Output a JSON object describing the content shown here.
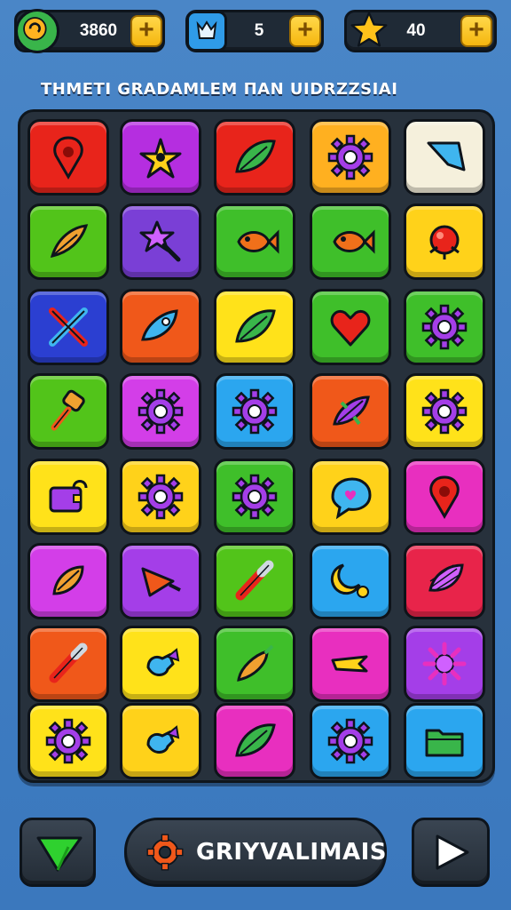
{
  "hud": {
    "coins": {
      "value": "3860",
      "icon": "swirl-coin-icon",
      "color": "#39b54a"
    },
    "powerups": {
      "value": "5",
      "icon": "cat-powerup-icon",
      "color": "#2f9be8"
    },
    "stars": {
      "value": "40",
      "icon": "star-icon",
      "color": "#ffc21a"
    },
    "plus_label": "+"
  },
  "subtitle": "THMETI GRADAMLEM ΠΑΝ UIDRZZSIAI",
  "board": {
    "rows": [
      [
        {
          "color": "#e8241b",
          "icon": "map-pin-icon"
        },
        {
          "color": "#b52ee0",
          "icon": "starfish-icon"
        },
        {
          "color": "#e8241b",
          "icon": "leaf-icon"
        },
        {
          "color": "#ffb020",
          "icon": "gear-icon"
        },
        {
          "color": "#f5f0dc",
          "icon": "sail-shard-icon"
        }
      ],
      [
        {
          "color": "#52c41a",
          "icon": "feather-icon"
        },
        {
          "color": "#7a3fd6",
          "icon": "star-wand-icon"
        },
        {
          "color": "#3fbf2a",
          "icon": "fish-icon"
        },
        {
          "color": "#3fbf2a",
          "icon": "fish-icon"
        },
        {
          "color": "#ffd21a",
          "icon": "beetle-icon"
        }
      ],
      [
        {
          "color": "#2b3fd1",
          "icon": "crossed-swords-icon"
        },
        {
          "color": "#f0581a",
          "icon": "rocket-icon"
        },
        {
          "color": "#ffe21a",
          "icon": "leaf-icon"
        },
        {
          "color": "#3fbf2a",
          "icon": "heart-icon"
        },
        {
          "color": "#3fbf2a",
          "icon": "gear-icon"
        }
      ],
      [
        {
          "color": "#52c41a",
          "icon": "hammer-icon"
        },
        {
          "color": "#d33ee8",
          "icon": "gear-icon"
        },
        {
          "color": "#2ba6ef",
          "icon": "gear-icon"
        },
        {
          "color": "#f0581a",
          "icon": "bug-icon"
        },
        {
          "color": "#ffe21a",
          "icon": "gear-icon"
        }
      ],
      [
        {
          "color": "#ffe21a",
          "icon": "purse-icon"
        },
        {
          "color": "#ffd21a",
          "icon": "gear-icon"
        },
        {
          "color": "#3fbf2a",
          "icon": "gear-icon"
        },
        {
          "color": "#ffd21a",
          "icon": "chat-bubble-icon"
        },
        {
          "color": "#e82fbf",
          "icon": "map-pin-icon"
        }
      ],
      [
        {
          "color": "#d33ee8",
          "icon": "seed-icon"
        },
        {
          "color": "#a43ee8",
          "icon": "cone-icon"
        },
        {
          "color": "#52c41a",
          "icon": "pencil-icon"
        },
        {
          "color": "#2ba6ef",
          "icon": "moon-gear-icon"
        },
        {
          "color": "#e8244a",
          "icon": "squid-icon"
        }
      ],
      [
        {
          "color": "#f0581a",
          "icon": "pencil-icon"
        },
        {
          "color": "#ffe21a",
          "icon": "candy-icon"
        },
        {
          "color": "#3fbf2a",
          "icon": "carrot-icon"
        },
        {
          "color": "#e82fbf",
          "icon": "bone-icon"
        },
        {
          "color": "#a43ee8",
          "icon": "sun-flower-icon"
        }
      ],
      [
        {
          "color": "#ffe21a",
          "icon": "gear-icon"
        },
        {
          "color": "#ffd21a",
          "icon": "candy-icon"
        },
        {
          "color": "#e82fbf",
          "icon": "leaf-icon"
        },
        {
          "color": "#2ba6ef",
          "icon": "gear-icon"
        },
        {
          "color": "#2ba6ef",
          "icon": "folder-icon"
        }
      ]
    ]
  },
  "controls": {
    "left_button": {
      "icon": "green-arrow-icon"
    },
    "center_button": {
      "icon": "orange-gear-icon",
      "label": "GRIYVALIMAIS"
    },
    "right_button": {
      "icon": "play-icon"
    }
  }
}
